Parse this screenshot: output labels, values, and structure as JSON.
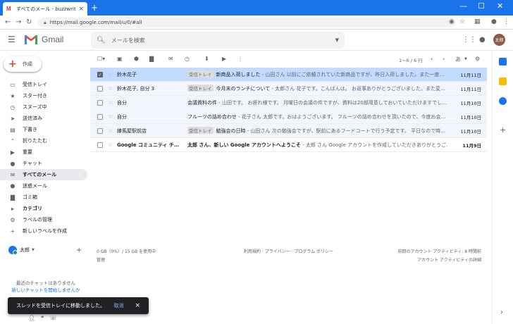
{
  "browser": {
    "tab_title": "すべてのメール - buzzwriter.zz@gm",
    "tab_close": "×",
    "new_tab": "+",
    "url": "https://mail.google.com/mail/u/0/#all"
  },
  "header": {
    "app_name": "Gmail",
    "search_placeholder": "メールを検索",
    "avatar_text": "太郎"
  },
  "sidebar": {
    "compose_label": "作成",
    "items": [
      {
        "label": "受信トレイ",
        "icon": "inbox-icon"
      },
      {
        "label": "スター付き",
        "icon": "star-icon"
      },
      {
        "label": "スヌーズ中",
        "icon": "clock-icon"
      },
      {
        "label": "送信済み",
        "icon": "send-icon"
      },
      {
        "label": "下書き",
        "icon": "draft-icon"
      },
      {
        "label": "折りたたむ",
        "icon": "chevron-up-icon"
      },
      {
        "label": "重要",
        "icon": "important-icon"
      },
      {
        "label": "チャット",
        "icon": "chat-icon"
      },
      {
        "label": "すべてのメール",
        "icon": "all-mail-icon"
      },
      {
        "label": "迷惑メール",
        "icon": "spam-icon"
      },
      {
        "label": "ゴミ箱",
        "icon": "trash-icon"
      },
      {
        "label": "カテゴリ",
        "icon": "label-icon"
      },
      {
        "label": "ラベルの管理",
        "icon": "gear-icon"
      },
      {
        "label": "新しいラベルを作成",
        "icon": "plus-icon"
      }
    ],
    "chat_user": "太郎",
    "no_chat_text": "最近のチャットはありません",
    "start_chat_link": "新しいチャットを開始しませんか"
  },
  "toolbar": {
    "pagination": "1～6 / 6 行",
    "input_tool": "あ"
  },
  "emails": [
    {
      "sender": "鈴木花子",
      "label": "受信トレイ",
      "subject": "新商品入荷しました",
      "snippet": " - 山田さん 以前にご依頼されていた新商品ですが、昨日入荷しました。また一度…",
      "date": "11月11日",
      "selected": true,
      "unread": false
    },
    {
      "sender": "鈴木花子, 自分 3",
      "label": "受信トレイ",
      "subject": "今月末のランチについて",
      "snippet": " - 太郎さん 花子です。こんばんは。 お返事ありがとうございました。また変…",
      "date": "11月11日",
      "selected": false,
      "unread": false
    },
    {
      "sender": "自分",
      "label": "",
      "subject": "会議資料の件",
      "snippet": " - 山田です。 お疲れ様です。 月曜日の会議の件ですが、資料は20部用意しておいていただけますでし…",
      "date": "11月10日",
      "selected": false,
      "unread": false
    },
    {
      "sender": "自分",
      "label": "",
      "subject": "フルーツの詰め合わせ",
      "snippet": " - 花子さん 太郎です。おはようございます。 フルーツの詰め合わせを頂いたので、今度お会…",
      "date": "11月10日",
      "selected": false,
      "unread": false
    },
    {
      "sender": "練馬屋駅前店",
      "label": "受信トレイ",
      "subject": "勉強会の日時",
      "snippet": " - 山田さん 次の勉強会ですが、駅前にあるフードコートで行う予定です。 平日なので時…",
      "date": "11月10日",
      "selected": false,
      "unread": false
    },
    {
      "sender": "Google コミュニティ チ…",
      "label": "",
      "subject": "太郎 さん、新しい Google アカウントへようこそ",
      "snippet": " - 太郎 さん Google アカウントを作成していただきありがとうご…",
      "date": "11月9日",
      "selected": false,
      "unread": true
    }
  ],
  "footer": {
    "storage": "0 GB（0%）/ 15 GB を使用中",
    "manage": "管理",
    "terms": "利用規約 · プライバシー · プログラム ポリシー",
    "activity": "前回のアカウント アクティビティ: 8 時間前",
    "activity_detail": "アカウント アクティビティの詳細"
  },
  "snackbar": {
    "message": "スレッドを受信トレイに移動しました。",
    "undo": "取消",
    "close": "×"
  },
  "colors": {
    "chrome_blue": "#1a73e8",
    "selected_row": "#c2dbff",
    "read_row": "#f2f6fc",
    "snackbar": "#202124",
    "link": "#1a73e8"
  }
}
